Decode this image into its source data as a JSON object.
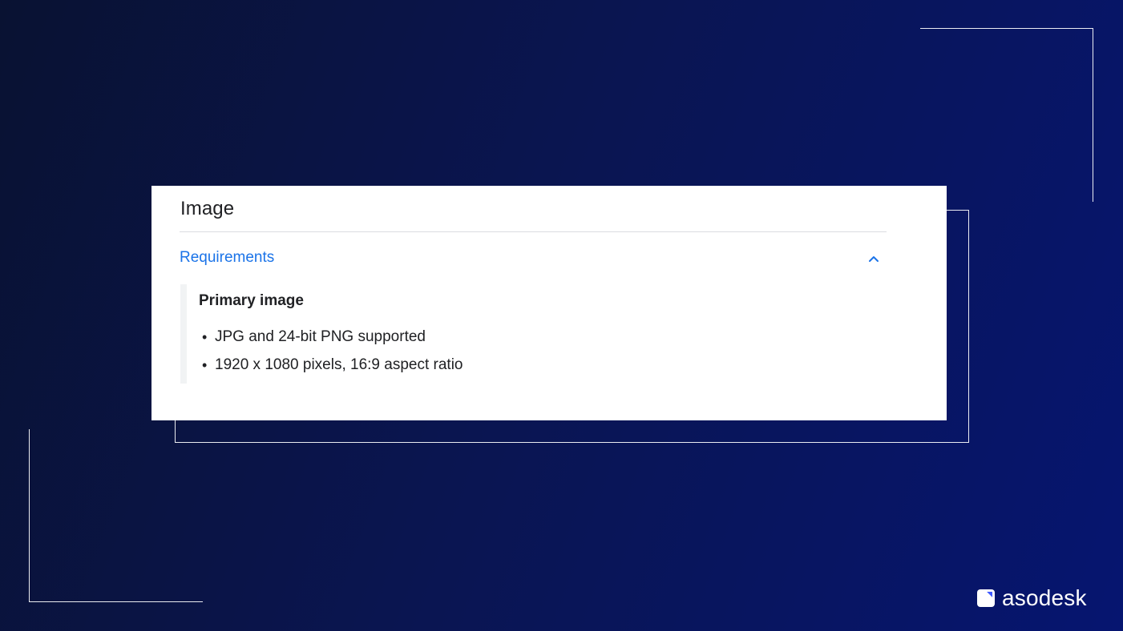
{
  "card": {
    "title": "Image",
    "accordion": {
      "label": "Requirements",
      "expanded": true,
      "toggle_icon": "chevron-up-icon"
    },
    "requirements": {
      "heading": "Primary image",
      "items": [
        "JPG and 24-bit PNG supported",
        "1920 x 1080 pixels, 16:9 aspect ratio"
      ],
      "bullet": "•"
    }
  },
  "brand": {
    "name": "asodesk",
    "logo_icon": "asodesk-logo-icon"
  },
  "colors": {
    "background_start": "#091232",
    "background_end": "#061570",
    "accent_blue": "#1a73e8",
    "text_primary": "#202124",
    "divider": "#dadce0",
    "panel_border": "#f1f3f4",
    "white": "#ffffff"
  }
}
